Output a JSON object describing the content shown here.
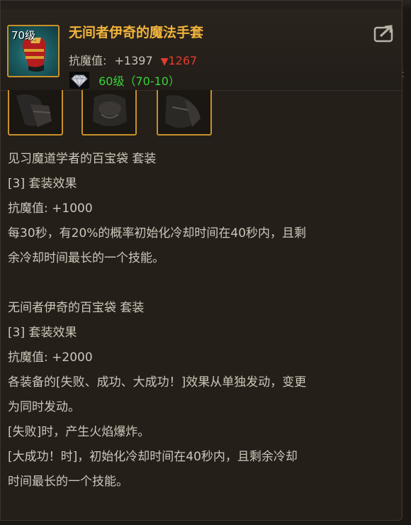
{
  "item": {
    "level": "70级",
    "name": "无间者伊奇的魔法手套",
    "stat_label": "抗魔值:",
    "stat_value": "+1397",
    "stat_diff": "1267",
    "gem_text": "60级（70-10）"
  },
  "icons": {
    "item": "red-gold-gauntlet-icon",
    "share": "share-arrow-icon",
    "gem": "diamond-gem-icon",
    "set_pieces": [
      "dark-armor-piece-icon",
      "dark-armor-piece-icon",
      "dark-armor-piece-icon"
    ]
  },
  "set1": {
    "title": "见习魔道学者的百宝袋  套装",
    "effect_header": "[3] 套装效果",
    "stat": "抗魔值: +1000",
    "desc_line1": "每30秒，有20%的概率初始化冷却时间在40秒内，且剩",
    "desc_line2": "余冷却时间最长的一个技能。"
  },
  "set2": {
    "title": "无间者伊奇的百宝袋  套装",
    "effect_header": "[3] 套装效果",
    "stat": "抗魔值: +2000",
    "desc_line1": "各装备的[失败、成功、大成功！]效果从单独发动，变更",
    "desc_line2": "为同时发动。",
    "desc_line3": "[失败]时，产生火焰爆炸。",
    "desc_line4": "[大成功！时]，初始化冷却时间在40秒内，且剩余冷却",
    "desc_line5": "时间最长的一个技能。"
  },
  "colors": {
    "name": "#f0b33c",
    "diff": "#e23b2f",
    "gem": "#39d33a",
    "border": "#c8912a",
    "text": "#cdc6ba"
  }
}
